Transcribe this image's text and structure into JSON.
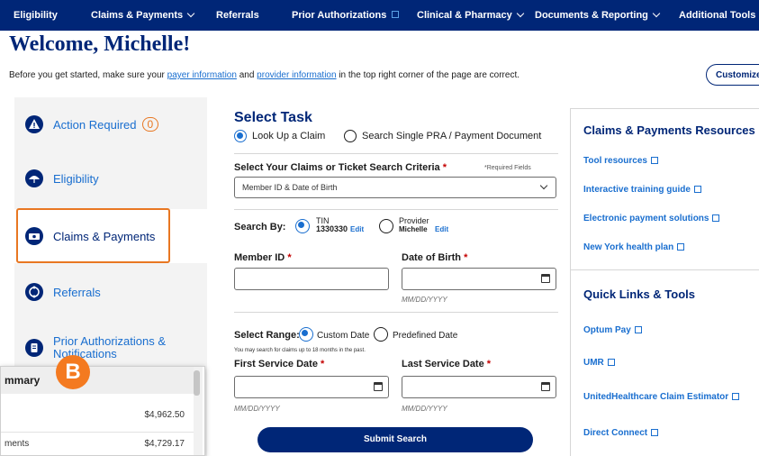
{
  "nav": {
    "items": [
      "Eligibility",
      "Claims & Payments",
      "Referrals",
      "Prior Authorizations",
      "Clinical & Pharmacy",
      "Documents & Reporting",
      "Additional Tools"
    ]
  },
  "header": {
    "welcome": "Welcome, Michelle!",
    "intro_pre": "Before you get started, make sure your ",
    "intro_link1": "payer information",
    "intro_mid": " and ",
    "intro_link2": "provider information",
    "intro_post": " in the top right corner of the page are correct.",
    "customize": "Customize"
  },
  "sidebar": {
    "items": [
      {
        "label": "Action Required",
        "count": "0"
      },
      {
        "label": "Eligibility"
      },
      {
        "label": "Claims & Payments"
      },
      {
        "label": "Referrals"
      },
      {
        "label": "Prior Authorizations & Notifications"
      }
    ]
  },
  "task": {
    "title": "Select Task",
    "opt1": "Look Up a Claim",
    "opt2": "Search Single PRA / Payment Document",
    "criteria_label": "Select Your Claims or Ticket Search Criteria",
    "required_note": "*Required Fields",
    "criteria_value": "Member ID & Date of Birth",
    "search_by": "Search By:",
    "tin_label": "TIN",
    "tin_value": "1330330",
    "edit": "Edit",
    "provider_label": "Provider",
    "provider_value": "Michelle",
    "member_id": "Member ID",
    "dob": "Date of Birth",
    "date_hint": "MM/DD/YYYY",
    "range_label": "Select Range:",
    "custom_date": "Custom Date",
    "predefined_date": "Predefined Date",
    "range_note": "You may search for claims up to 18 months in the past.",
    "first_service": "First Service Date",
    "last_service": "Last Service Date",
    "submit": "Submit Search"
  },
  "resources": {
    "title1": "Claims & Payments Resources",
    "links1": [
      "Tool resources",
      "Interactive training guide",
      "Electronic payment solutions",
      "New York health plan"
    ],
    "title2": "Quick Links & Tools",
    "links2": [
      "Optum Pay",
      "UMR",
      "UnitedHealthcare Claim Estimator",
      "Direct Connect"
    ]
  },
  "overlay": {
    "badge": "B",
    "title": "mmary",
    "row1_value": "$4,962.50",
    "row2_label": "ments",
    "row2_value": "$4,729.17"
  }
}
